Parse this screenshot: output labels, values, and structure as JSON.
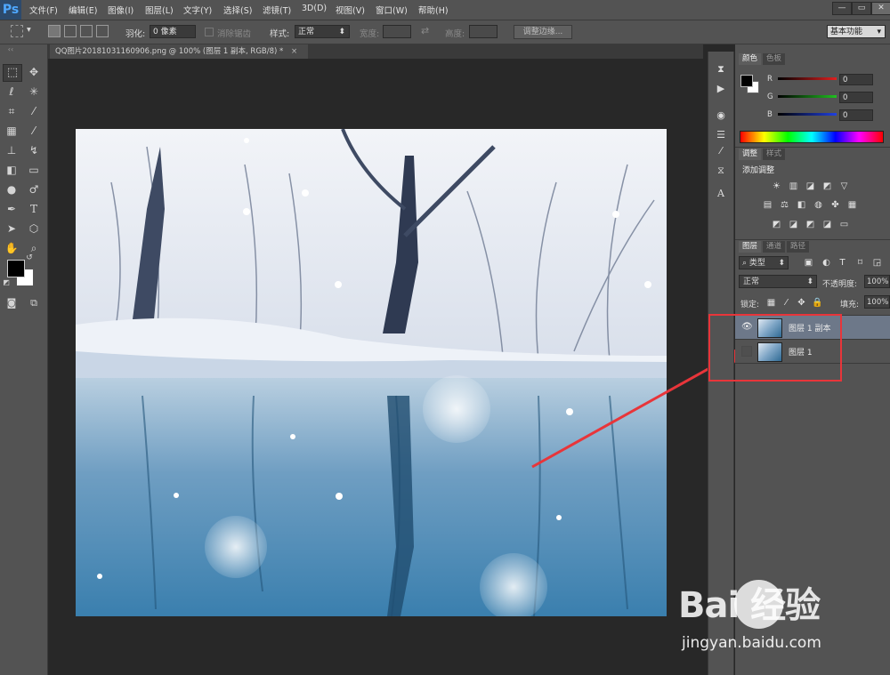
{
  "app": {
    "logo": "Ps"
  },
  "menu": [
    "文件(F)",
    "编辑(E)",
    "图像(I)",
    "图层(L)",
    "文字(Y)",
    "选择(S)",
    "滤镜(T)",
    "3D(D)",
    "视图(V)",
    "窗口(W)",
    "帮助(H)"
  ],
  "window_controls": {
    "minimize": "—",
    "restore": "▭",
    "close": "✕"
  },
  "options": {
    "feather_label": "羽化:",
    "feather_value": "0 像素",
    "antialias_label": "消除锯齿",
    "style_label": "样式:",
    "style_value": "正常",
    "width_label": "宽度:",
    "height_label": "高度:",
    "refine_edge": "调整边缘...",
    "workspace": "基本功能"
  },
  "document": {
    "tab_title": "QQ图片20181031160906.png @ 100% (图层 1 副本, RGB/8) *",
    "close": "×"
  },
  "color_panel": {
    "tabs": [
      "颜色",
      "色板"
    ],
    "channels": [
      {
        "label": "R",
        "value": "0",
        "color": "#e02020"
      },
      {
        "label": "G",
        "value": "0",
        "color": "#20c020"
      },
      {
        "label": "B",
        "value": "0",
        "color": "#2040e0"
      }
    ]
  },
  "adjust_panel": {
    "tabs": [
      "调整",
      "样式"
    ],
    "title": "添加调整"
  },
  "layers_panel": {
    "tabs": [
      "图层",
      "通道",
      "路径"
    ],
    "filter_kind": "类型",
    "blend_mode": "正常",
    "opacity_label": "不透明度:",
    "opacity_value": "100%",
    "lock_label": "锁定:",
    "fill_label": "填充:",
    "fill_value": "100%",
    "layers": [
      {
        "name": "图层 1 副本",
        "visible": true,
        "selected": true
      },
      {
        "name": "图层 1",
        "visible": false,
        "selected": false
      }
    ]
  },
  "annotation": {
    "color": "#e8353a"
  },
  "watermark": {
    "logo": "Bai 经验",
    "url": "jingyan.baidu.com"
  }
}
